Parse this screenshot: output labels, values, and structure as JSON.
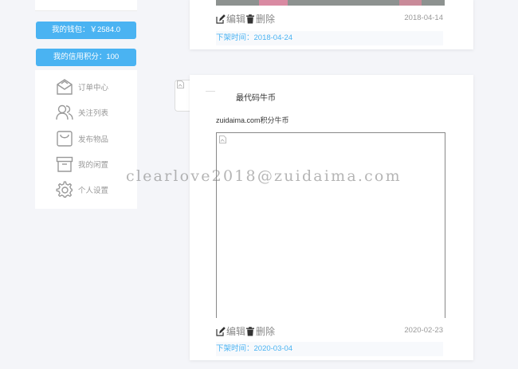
{
  "sidebar": {
    "wallet_label": "我的钱包：￥2584.0",
    "credit_label": "我的信用积分：100",
    "menu": [
      {
        "label": "订单中心",
        "icon": "order-icon"
      },
      {
        "label": "关注列表",
        "icon": "users-icon"
      },
      {
        "label": "发布物品",
        "icon": "bag-icon"
      },
      {
        "label": "我的闲置",
        "icon": "box-icon"
      },
      {
        "label": "个人设置",
        "icon": "gear-icon"
      }
    ]
  },
  "cards": [
    {
      "edit_label": "编辑",
      "delete_label": "删除",
      "date": "2018-04-14",
      "offline": "下架时间：2018-04-24"
    },
    {
      "title": "最代码牛币",
      "description": "zuidaima.com积分牛币",
      "edit_label": "编辑",
      "delete_label": "删除",
      "date": "2020-02-23",
      "offline": "下架时间：2020-03-04"
    }
  ],
  "watermark": "clearlove2018@zuidaima.com",
  "colors": {
    "accent": "#4ab3f2",
    "background": "#f4f5f9"
  }
}
